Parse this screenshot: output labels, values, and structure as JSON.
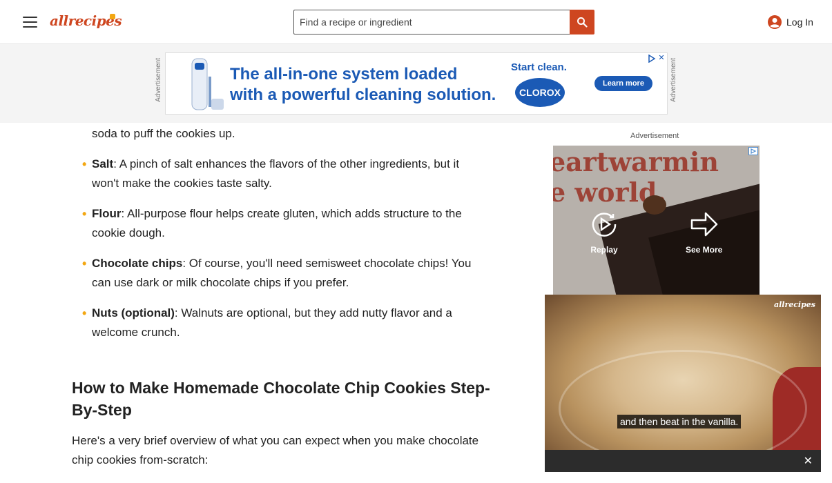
{
  "header": {
    "logo": "allrecipes",
    "search_placeholder": "Find a recipe or ingredient",
    "login_label": "Log In"
  },
  "top_ad": {
    "label": "Advertisement",
    "headline_line1": "The all-in-one system loaded",
    "headline_line2": "with a powerful cleaning solution.",
    "start_clean": "Start clean.",
    "brand": "CLOROX",
    "cta": "Learn more"
  },
  "article": {
    "first_fragment": "soda to puff the cookies up.",
    "bullets": [
      {
        "term": "Salt",
        "text": ": A pinch of salt enhances the flavors of the other ingredients, but it won't make the cookies taste salty."
      },
      {
        "term": "Flour",
        "text": ": All-purpose flour helps create gluten, which adds structure to the cookie dough."
      },
      {
        "term": "Chocolate chips",
        "text": ": Of course, you'll need semisweet chocolate chips! You can use dark or milk chocolate chips if you prefer."
      },
      {
        "term": "Nuts (optional)",
        "text": ": Walnuts are optional, but they add nutty flavor and a welcome crunch."
      }
    ],
    "section_title": "How to Make Homemade Chocolate Chip Cookies Step-By-Step",
    "intro": "Here's a very brief overview of what you can expect when you make chocolate chip cookies from-scratch:"
  },
  "side_ad": {
    "label": "Advertisement",
    "bg_text_line1": "eartwarmin",
    "bg_text_line2": "e world.",
    "replay_label": "Replay",
    "see_more_label": "See More"
  },
  "video": {
    "logo": "allrecipes",
    "caption": "and then beat in the vanilla."
  },
  "colors": {
    "brand": "#ce4620",
    "bullet": "#f3a712",
    "ad_blue": "#1b5ab5"
  }
}
